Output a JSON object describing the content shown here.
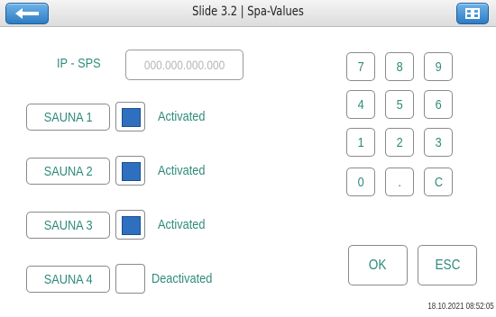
{
  "header": {
    "title": "Slide 3.2 | Spa-Values",
    "back_icon": "arrow-left-icon",
    "home_icon": "grid-icon"
  },
  "ip": {
    "label": "IP - SPS",
    "placeholder": "000.000.000.000"
  },
  "saunas": [
    {
      "label": "SAUNA 1",
      "status": "Activated",
      "active": true
    },
    {
      "label": "SAUNA 2",
      "status": "Activated",
      "active": true
    },
    {
      "label": "SAUNA 3",
      "status": "Activated",
      "active": true
    },
    {
      "label": "SAUNA 4",
      "status": "Deactivated",
      "active": false
    }
  ],
  "keypad": [
    "7",
    "8",
    "9",
    "4",
    "5",
    "6",
    "1",
    "2",
    "3",
    "0",
    ".",
    "C"
  ],
  "actions": {
    "ok": "OK",
    "esc": "ESC"
  },
  "timestamp": "18.10.2021 08:52:05",
  "colors": {
    "accent_text": "#2e8b7a",
    "toggle_fill": "#2f6fbf",
    "nav_button": "#2e7cc4"
  }
}
